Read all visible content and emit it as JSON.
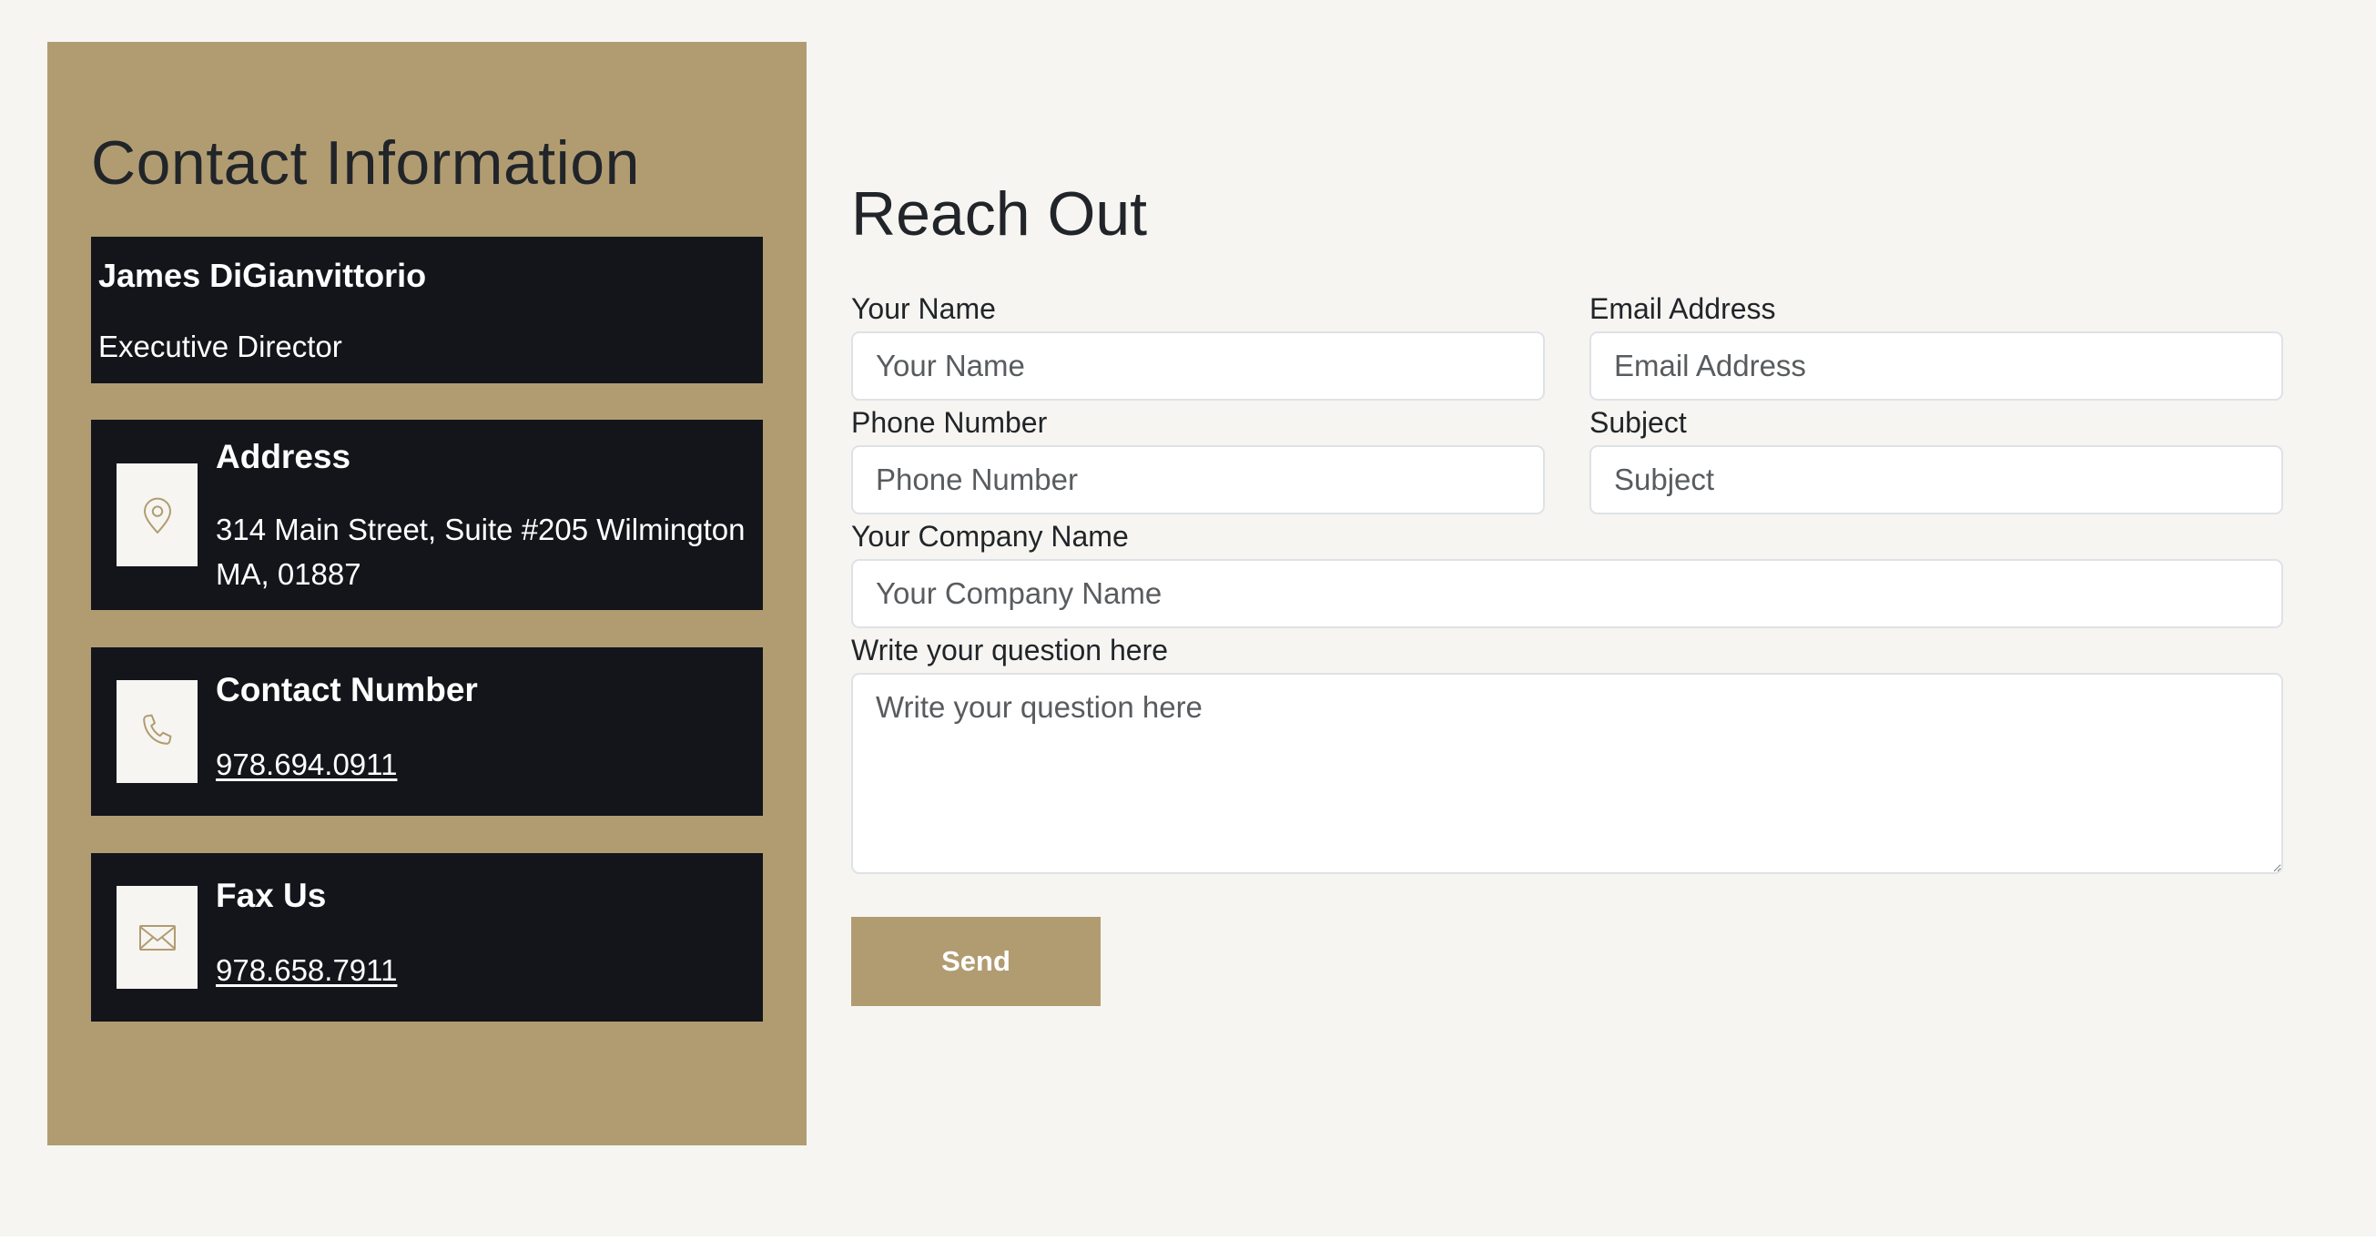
{
  "contact_info": {
    "title": "Contact Information",
    "person": {
      "name": "James DiGianvittorio",
      "role": "Executive Director"
    },
    "address": {
      "heading": "Address",
      "line1": "314 Main Street, Suite #205 Wilmington",
      "line2": "MA, 01887",
      "icon": "map-pin-icon"
    },
    "phone": {
      "heading": "Contact Number",
      "value": "978.694.0911",
      "icon": "phone-icon"
    },
    "fax": {
      "heading": "Fax Us",
      "value": "978.658.7911",
      "icon": "envelope-icon"
    }
  },
  "form": {
    "title": "Reach Out",
    "name": {
      "label": "Your Name",
      "placeholder": "Your Name"
    },
    "email": {
      "label": "Email Address",
      "placeholder": "Email Address"
    },
    "phone": {
      "label": "Phone Number",
      "placeholder": "Phone Number"
    },
    "subject": {
      "label": "Subject",
      "placeholder": "Subject"
    },
    "company": {
      "label": "Your Company Name",
      "placeholder": "Your Company Name"
    },
    "question": {
      "label": "Write your question here",
      "placeholder": "Write your question here"
    },
    "send_label": "Send"
  },
  "colors": {
    "accent": "#b19c72",
    "card_bg": "#13151b",
    "page_bg": "#f6f5f1"
  }
}
